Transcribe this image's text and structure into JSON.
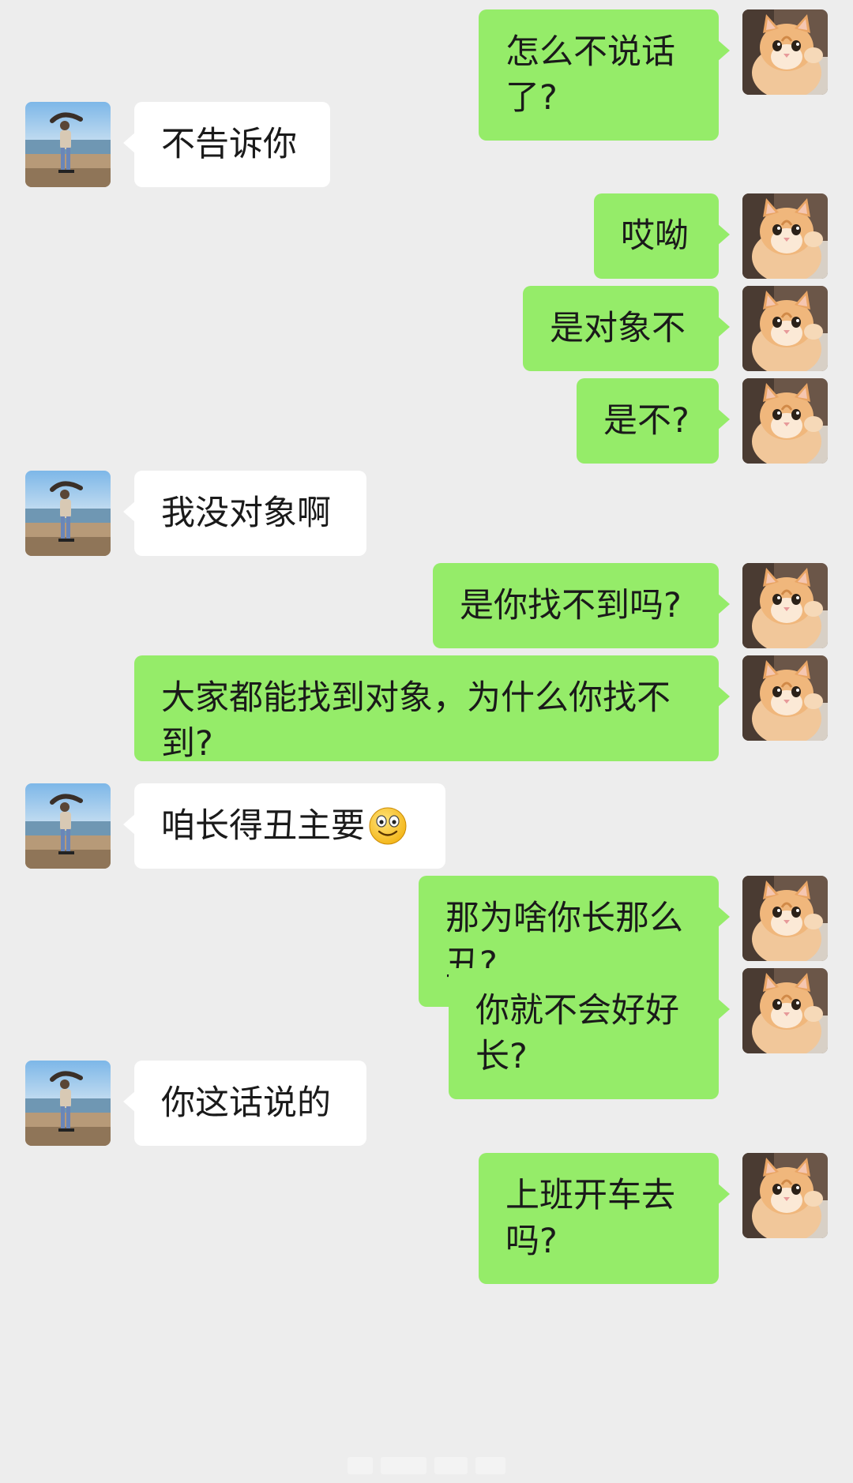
{
  "colors": {
    "background": "#ededed",
    "sent_bubble": "#95ec69",
    "received_bubble": "#ffffff"
  },
  "avatars": {
    "self": "cat-avatar",
    "contact": "beach-person-avatar"
  },
  "messages": [
    {
      "side": "right",
      "text": "怎么不说话了?"
    },
    {
      "side": "left",
      "text": "不告诉你"
    },
    {
      "side": "right",
      "text": "哎呦"
    },
    {
      "side": "right",
      "text": "是对象不"
    },
    {
      "side": "right",
      "text": "是不?"
    },
    {
      "side": "left",
      "text": "我没对象啊"
    },
    {
      "side": "right",
      "text": "是你找不到吗?"
    },
    {
      "side": "right",
      "text": "大家都能找到对象，为什么你找不到?"
    },
    {
      "side": "left",
      "text": "咱长得丑主要",
      "emoji": "smile-emoji"
    },
    {
      "side": "right",
      "text": "那为啥你长那么丑?"
    },
    {
      "side": "right",
      "text": "你就不会好好长?"
    },
    {
      "side": "left",
      "text": "你这话说的"
    },
    {
      "side": "right",
      "text": "上班开车去吗?"
    }
  ]
}
